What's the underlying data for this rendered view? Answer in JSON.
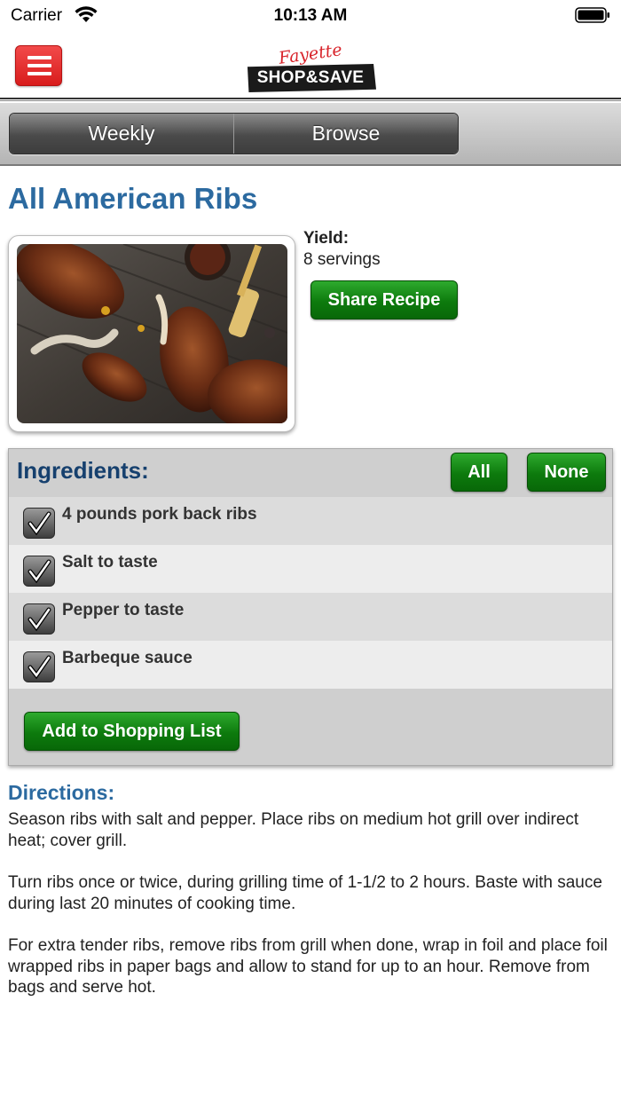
{
  "status_bar": {
    "carrier": "Carrier",
    "time": "10:13 AM"
  },
  "header": {
    "logo_script": "Fayette",
    "logo_text": "SHOP&SAVE",
    "menu_icon": "hamburger-menu-icon",
    "menu_color": "#e02626"
  },
  "tabs": [
    {
      "label": "Weekly"
    },
    {
      "label": "Browse"
    }
  ],
  "recipe": {
    "title": "All American Ribs",
    "yield_label": "Yield:",
    "yield_value": "8 servings",
    "share_label": "Share Recipe"
  },
  "ingredients": {
    "title": "Ingredients:",
    "all_label": "All",
    "none_label": "None",
    "items": [
      {
        "text": "4 pounds pork back ribs",
        "checked": true
      },
      {
        "text": "Salt to taste",
        "checked": true
      },
      {
        "text": "Pepper to taste",
        "checked": true
      },
      {
        "text": "Barbeque sauce",
        "checked": true
      }
    ],
    "add_label": "Add to Shopping List"
  },
  "directions": {
    "title": "Directions:",
    "paragraphs": [
      "Season ribs with salt and pepper. Place ribs on medium hot grill over indirect heat; cover grill.",
      "Turn ribs once or twice, during grilling time of 1-1/2 to 2 hours. Baste with sauce during last 20 minutes of cooking time.",
      "For extra tender ribs, remove ribs from grill when done, wrap in foil and place foil wrapped ribs in paper bags and allow to stand for up to an hour. Remove from bags and serve hot."
    ]
  },
  "colors": {
    "accent_blue": "#2c6aa0",
    "button_green": "#0d7a0d"
  }
}
